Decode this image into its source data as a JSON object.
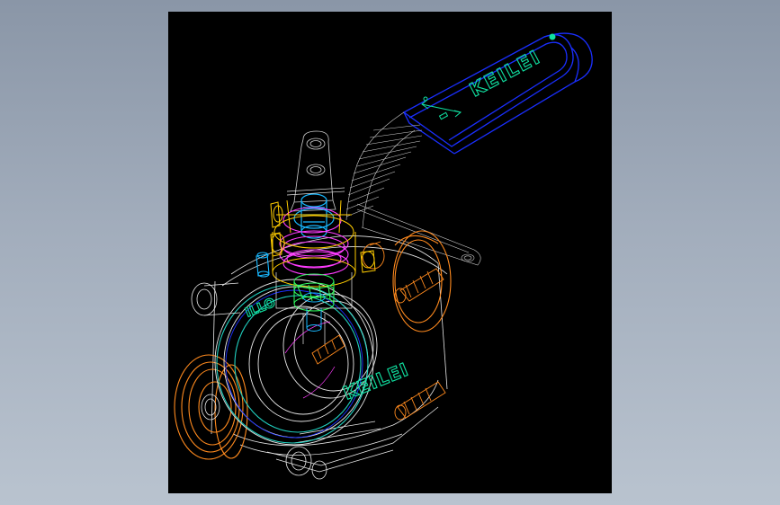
{
  "drawing": {
    "subject": "3-piece ball valve",
    "background_color": "#000000",
    "handle_brand_text": "KEILEI",
    "body_brand_text": "KEILEI",
    "colors": {
      "handle_outline": "#1a2fff",
      "handle_text": "#10e0a0",
      "body_lines": "#ffffff",
      "flange_orange": "#ff8a1e",
      "stem_cyan": "#18b8ff",
      "stem_magenta": "#ff3cff",
      "packing_yellow": "#ffcc00",
      "gland_green": "#30ff60",
      "seat_teal": "#20d0c0"
    }
  }
}
